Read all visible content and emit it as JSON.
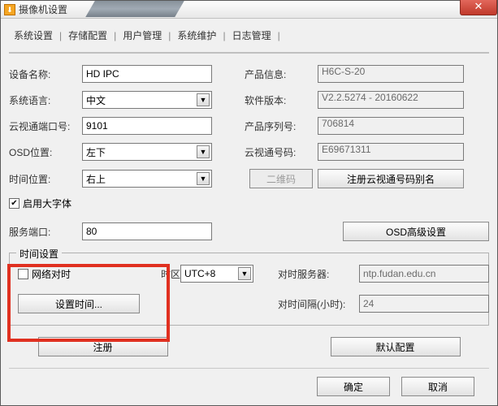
{
  "window": {
    "title": "摄像机设置"
  },
  "tabs": [
    "系统设置",
    "存储配置",
    "用户管理",
    "系统维护",
    "日志管理"
  ],
  "left": {
    "device_name_label": "设备名称:",
    "device_name": "HD IPC",
    "system_lang_label": "系统语言:",
    "system_lang": "中文",
    "cloud_port_label": "云视通端口号:",
    "cloud_port": "9101",
    "osd_pos_label": "OSD位置:",
    "osd_pos": "左下",
    "time_pos_label": "时间位置:",
    "time_pos": "右上",
    "big_font_label": "启用大字体",
    "service_port_label": "服务端口:",
    "service_port": "80"
  },
  "right": {
    "product_info_label": "产品信息:",
    "product_info": "H6C-S-20",
    "sw_version_label": "软件版本:",
    "sw_version": "V2.2.5274 - 20160622",
    "product_sn_label": "产品序列号:",
    "product_sn": "706814",
    "cloud_id_label": "云视通号码:",
    "cloud_id": "E69671311",
    "qr_btn": "二维码",
    "register_alias_btn": "注册云视通号码别名",
    "osd_adv_btn": "OSD高级设置"
  },
  "time_group": {
    "title": "时间设置",
    "ntp_label": "网络对时",
    "tz_label": "时区",
    "tz_value": "UTC+8",
    "set_time_btn": "设置时间...",
    "ntp_server_label": "对时服务器:",
    "ntp_server": "ntp.fudan.edu.cn",
    "interval_label": "对时间隔(小时):",
    "interval": "24"
  },
  "buttons": {
    "register": "注册",
    "default_cfg": "默认配置",
    "ok": "确定",
    "cancel": "取消"
  }
}
